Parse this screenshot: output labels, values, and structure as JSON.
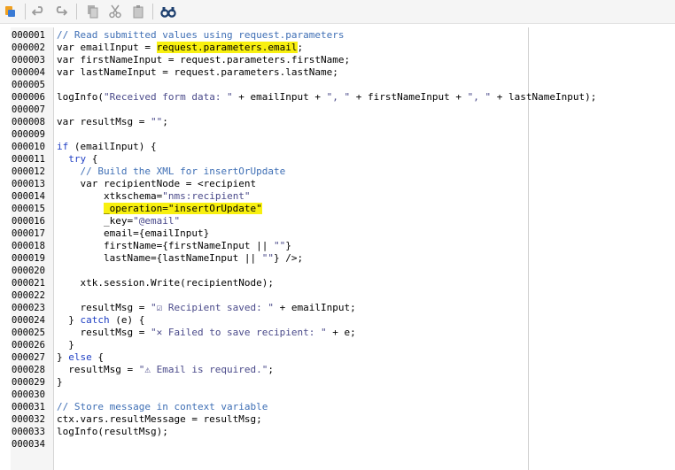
{
  "toolbar": {
    "buttons": [
      {
        "icon": "script-icon"
      },
      {
        "icon": "undo-icon"
      },
      {
        "icon": "redo-icon"
      },
      {
        "icon": "copy-icon"
      },
      {
        "icon": "cut-icon"
      },
      {
        "icon": "paste-icon"
      },
      {
        "icon": "find-icon"
      }
    ]
  },
  "editor": {
    "highlight_color": "#f8f00f",
    "lines": [
      {
        "num": "000001",
        "tokens": [
          {
            "t": "// Read submitted values using request.parameters",
            "c": "c"
          }
        ]
      },
      {
        "num": "000002",
        "tokens": [
          {
            "t": "var emailInput = "
          },
          {
            "t": "request.parameters.email",
            "c": "hl"
          },
          {
            "t": ";"
          }
        ]
      },
      {
        "num": "000003",
        "tokens": [
          {
            "t": "var firstNameInput = request.parameters.firstName;"
          }
        ]
      },
      {
        "num": "000004",
        "tokens": [
          {
            "t": "var lastNameInput = request.parameters.lastName;"
          }
        ]
      },
      {
        "num": "000005",
        "tokens": []
      },
      {
        "num": "000006",
        "tokens": [
          {
            "t": "logInfo("
          },
          {
            "t": "\"Received form data: \"",
            "c": "s"
          },
          {
            "t": " + emailInput + "
          },
          {
            "t": "\", \"",
            "c": "s"
          },
          {
            "t": " + firstNameInput + "
          },
          {
            "t": "\", \"",
            "c": "s"
          },
          {
            "t": " + lastNameInput);"
          }
        ]
      },
      {
        "num": "000007",
        "tokens": []
      },
      {
        "num": "000008",
        "tokens": [
          {
            "t": "var resultMsg = "
          },
          {
            "t": "\"\"",
            "c": "s"
          },
          {
            "t": ";"
          }
        ]
      },
      {
        "num": "000009",
        "tokens": []
      },
      {
        "num": "000010",
        "tokens": [
          {
            "t": "if",
            "c": "k"
          },
          {
            "t": " (emailInput) {"
          }
        ]
      },
      {
        "num": "000011",
        "tokens": [
          {
            "t": "  "
          },
          {
            "t": "try",
            "c": "k"
          },
          {
            "t": " {"
          }
        ]
      },
      {
        "num": "000012",
        "tokens": [
          {
            "t": "    "
          },
          {
            "t": "// Build the XML for insertOrUpdate",
            "c": "c"
          }
        ]
      },
      {
        "num": "000013",
        "tokens": [
          {
            "t": "    var recipientNode = <recipient"
          }
        ]
      },
      {
        "num": "000014",
        "tokens": [
          {
            "t": "        xtkschema="
          },
          {
            "t": "\"nms:recipient\"",
            "c": "s"
          }
        ]
      },
      {
        "num": "000015",
        "tokens": [
          {
            "t": "        "
          },
          {
            "t": "_operation=\"insertOrUpdate\"",
            "c": "hl"
          }
        ]
      },
      {
        "num": "000016",
        "tokens": [
          {
            "t": "        _key="
          },
          {
            "t": "\"@email\"",
            "c": "s"
          }
        ]
      },
      {
        "num": "000017",
        "tokens": [
          {
            "t": "        email={emailInput}"
          }
        ]
      },
      {
        "num": "000018",
        "tokens": [
          {
            "t": "        firstName={firstNameInput || "
          },
          {
            "t": "\"\"",
            "c": "s"
          },
          {
            "t": "}"
          }
        ]
      },
      {
        "num": "000019",
        "tokens": [
          {
            "t": "        lastName={lastNameInput || "
          },
          {
            "t": "\"\"",
            "c": "s"
          },
          {
            "t": "} />;"
          }
        ]
      },
      {
        "num": "000020",
        "tokens": []
      },
      {
        "num": "000021",
        "tokens": [
          {
            "t": "    xtk.session.Write(recipientNode);"
          }
        ]
      },
      {
        "num": "000022",
        "tokens": []
      },
      {
        "num": "000023",
        "tokens": [
          {
            "t": "    resultMsg = "
          },
          {
            "t": "\"☑ Recipient saved: \"",
            "c": "s"
          },
          {
            "t": " + emailInput;"
          }
        ]
      },
      {
        "num": "000024",
        "tokens": [
          {
            "t": "  } "
          },
          {
            "t": "catch",
            "c": "k"
          },
          {
            "t": " (e) {"
          }
        ]
      },
      {
        "num": "000025",
        "tokens": [
          {
            "t": "    resultMsg = "
          },
          {
            "t": "\"✕ Failed to save recipient: \"",
            "c": "s"
          },
          {
            "t": " + e;"
          }
        ]
      },
      {
        "num": "000026",
        "tokens": [
          {
            "t": "  }"
          }
        ]
      },
      {
        "num": "000027",
        "tokens": [
          {
            "t": "} "
          },
          {
            "t": "else",
            "c": "k"
          },
          {
            "t": " {"
          }
        ]
      },
      {
        "num": "000028",
        "tokens": [
          {
            "t": "  resultMsg = "
          },
          {
            "t": "\"⚠ Email is required.\"",
            "c": "s"
          },
          {
            "t": ";"
          }
        ]
      },
      {
        "num": "000029",
        "tokens": [
          {
            "t": "}"
          }
        ]
      },
      {
        "num": "000030",
        "tokens": []
      },
      {
        "num": "000031",
        "tokens": [
          {
            "t": "// Store message in context variable",
            "c": "c"
          }
        ]
      },
      {
        "num": "000032",
        "tokens": [
          {
            "t": "ctx.vars.resultMessage = resultMsg;"
          }
        ]
      },
      {
        "num": "000033",
        "tokens": [
          {
            "t": "logInfo(resultMsg);"
          }
        ]
      },
      {
        "num": "000034",
        "tokens": []
      }
    ]
  }
}
